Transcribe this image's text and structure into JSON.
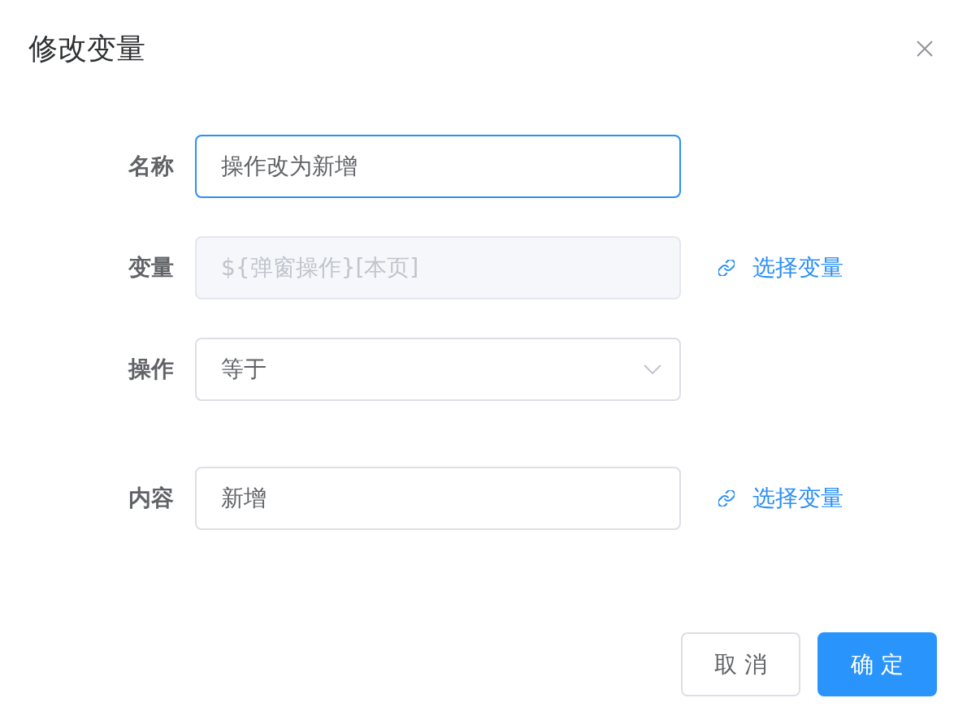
{
  "dialog": {
    "title": "修改变量"
  },
  "form": {
    "fields": [
      {
        "kind": "input",
        "label": "名称",
        "value": "操作改为新增",
        "focused": true,
        "disabled": false
      },
      {
        "kind": "input",
        "label": "变量",
        "value": "${弹窗操作}[本页]",
        "focused": false,
        "disabled": true,
        "link": "选择变量"
      },
      {
        "kind": "select",
        "label": "操作",
        "value": "等于",
        "focused": false,
        "disabled": false
      },
      {
        "kind": "input",
        "label": "内容",
        "value": "新增",
        "focused": false,
        "disabled": false,
        "link": "选择变量"
      }
    ]
  },
  "buttons": [
    {
      "kind": "default",
      "label": "取 消"
    },
    {
      "kind": "primary",
      "label": "确 定"
    }
  ]
}
